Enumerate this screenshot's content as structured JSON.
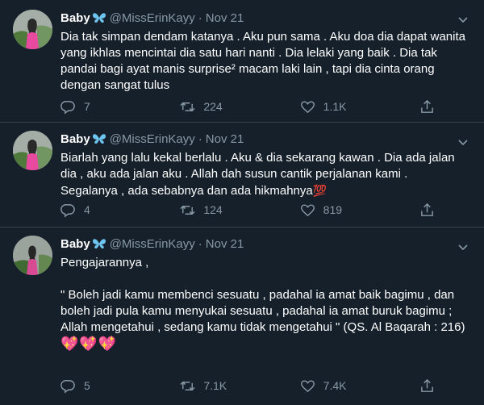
{
  "tweets": [
    {
      "name": "Baby",
      "handle": "@MissErinKayy",
      "date": "Nov 21",
      "text": "Dia tak simpan dendam katanya . Aku pun sama . Aku doa dia dapat wanita yang ikhlas mencintai dia satu hari nanti . Dia lelaki yang baik . Dia tak pandai bagi ayat manis surprise² macam laki lain , tapi dia cinta orang dengan sangat tulus",
      "emoji": "",
      "replies": "7",
      "retweets": "224",
      "likes": "1.1K"
    },
    {
      "name": "Baby",
      "handle": "@MissErinKayy",
      "date": "Nov 21",
      "text": "Biarlah yang lalu kekal berlalu . Aku & dia sekarang kawan . Dia ada jalan dia , aku ada jalan aku . Allah dah susun cantik perjalanan kami . Segalanya , ada sebabnya dan ada hikmahnya",
      "emoji": "💯",
      "replies": "4",
      "retweets": "124",
      "likes": "819"
    },
    {
      "name": "Baby",
      "handle": "@MissErinKayy",
      "date": "Nov 21",
      "text": "Pengajarannya ,\n\n\" Boleh jadi kamu membenci sesuatu , padahal ia amat baik bagimu , dan boleh jadi pula kamu menyukai sesuatu , padahal ia amat buruk bagimu ; Allah mengetahui , sedang kamu tidak mengetahui \" (QS. Al Baqarah : 216)\n",
      "emoji": "💖💖💖",
      "replies": "5",
      "retweets": "7.1K",
      "likes": "7.4K"
    }
  ],
  "icons": {
    "verified": "butterfly-icon",
    "more": "chevron-down-icon",
    "reply": "reply-icon",
    "retweet": "retweet-icon",
    "like": "heart-icon",
    "share": "share-icon"
  },
  "colors": {
    "background": "#15202b",
    "text": "#ffffff",
    "secondary": "#8899a6",
    "divider": "#38444d",
    "verified": "#6ec6f0"
  }
}
